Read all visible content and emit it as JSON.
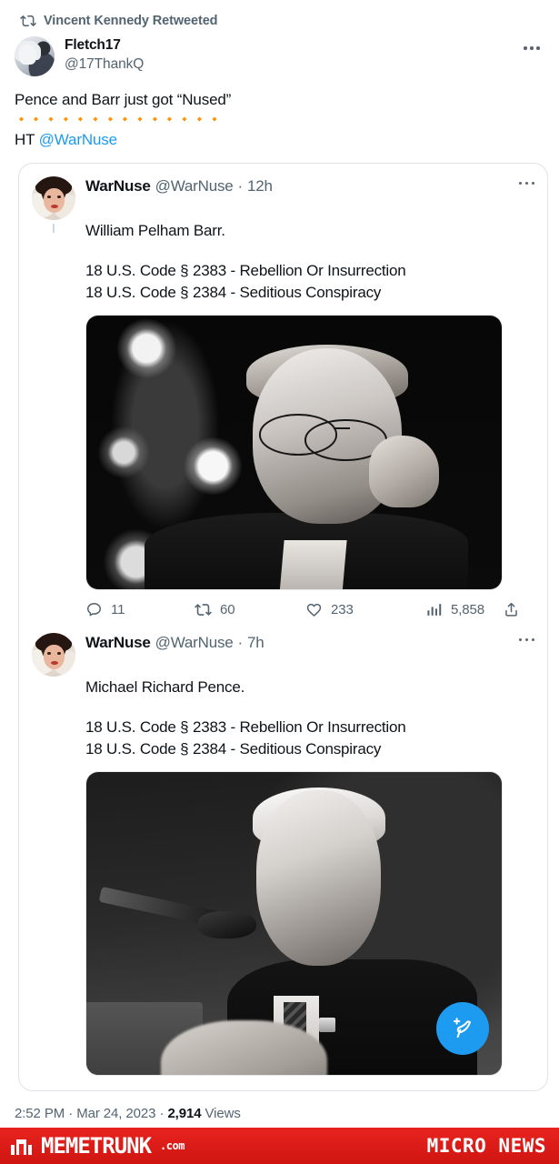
{
  "retweet": {
    "icon": "retweet-icon",
    "label": "Vincent Kennedy Retweeted"
  },
  "author": {
    "display_name": "Fletch17",
    "handle": "@17ThankQ",
    "avatar_alt": "grayscale-photo-person-raised-hand",
    "more_icon": "more-options-icon"
  },
  "tweet": {
    "text": "Pence and Barr just got “Nused”",
    "emoji_row": "🔸🔸🔸🔸🔸🔸🔸🔸🔸🔸🔸🔸🔸🔸",
    "ht_prefix": "HT ",
    "ht_mention": "@WarNuse"
  },
  "quoted": {
    "tweets": [
      {
        "name": "WarNuse",
        "handle": "@WarNuse",
        "separator": "·",
        "time": "12h",
        "avatar_alt": "vintage-portrait-woman-nurse",
        "more_icon": "more-options-icon",
        "body_line": "William Pelham Barr.",
        "code_lines": [
          "18 U.S. Code § 2383 - Rebellion Or Insurrection",
          "18 U.S. Code § 2384 - Seditious Conspiracy"
        ],
        "image_alt": "black-and-white-photo-william-barr-adjusting-glasses",
        "actions": {
          "reply_icon": "reply-icon",
          "reply_count": "11",
          "retweet_icon": "retweet-icon",
          "retweet_count": "60",
          "like_icon": "heart-icon",
          "like_count": "233",
          "views_icon": "analytics-icon",
          "views_count": "5,858",
          "share_icon": "share-icon"
        }
      },
      {
        "name": "WarNuse",
        "handle": "@WarNuse",
        "separator": "·",
        "time": "7h",
        "avatar_alt": "vintage-portrait-woman-nurse",
        "more_icon": "more-options-icon",
        "body_line": "Michael Richard Pence.",
        "code_lines": [
          "18 U.S. Code § 2383 - Rebellion Or Insurrection",
          "18 U.S. Code § 2384 - Seditious Conspiracy"
        ],
        "image_alt": "black-and-white-photo-mike-pence-at-podium-microphone",
        "compose_icon": "compose-tweet-icon"
      }
    ]
  },
  "footer": {
    "time": "2:52 PM",
    "sep1": " · ",
    "date": "Mar 24, 2023",
    "sep2": " · ",
    "views_count": "2,914",
    "views_label": " Views"
  },
  "banner": {
    "brand_name": "MEMETRUNK",
    "brand_suffix": ".com",
    "tagline": "MICRO NEWS",
    "background_color": "#e0201c"
  },
  "colors": {
    "link": "#1d9bf0",
    "text_primary": "#0f1419",
    "text_secondary": "#536471",
    "card_border": "#dfe3e7",
    "fab": "#1d9bf0"
  }
}
